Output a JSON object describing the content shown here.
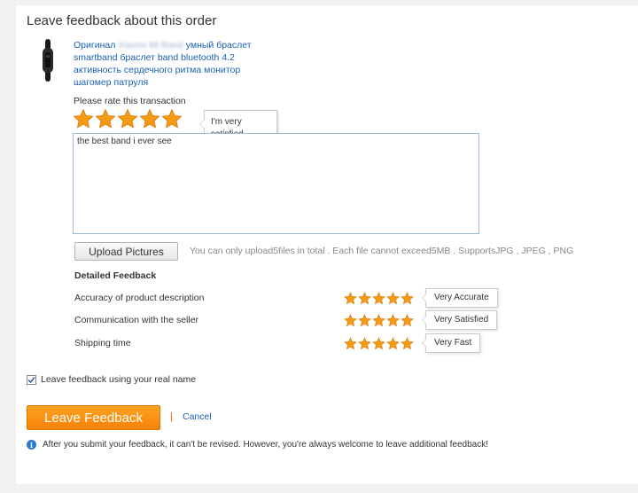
{
  "page": {
    "title": "Leave feedback about this order"
  },
  "product": {
    "title_prefix": "Оригинал",
    "title_blurred": "Xiaomi Mi Band",
    "title_suffix": "умный браслет smartband браслет band bluetooth 4.2 активность сердечного ритма монитор шагомер патруля"
  },
  "rating": {
    "label": "Please rate this transaction",
    "stars": 5,
    "max_stars": 5,
    "tooltip": "I'm very satisfied",
    "star_color": "#f49b15"
  },
  "feedback": {
    "text": "the best band i ever see"
  },
  "upload": {
    "button_label": "Upload Pictures",
    "hint": "You can only upload5files in total . Each file cannot exceed5MB . SupportsJPG , JPEG , PNG"
  },
  "detailed": {
    "heading": "Detailed Feedback",
    "rows": [
      {
        "label": "Accuracy of product description",
        "stars": 5,
        "tooltip": "Very Accurate"
      },
      {
        "label": "Communication with the seller",
        "stars": 5,
        "tooltip": "Very Satisfied"
      },
      {
        "label": "Shipping time",
        "stars": 5,
        "tooltip": "Very Fast"
      }
    ]
  },
  "options": {
    "real_name_label": "Leave feedback using your real name",
    "real_name_checked": true
  },
  "actions": {
    "submit_label": "Leave Feedback",
    "separator": "|",
    "cancel_label": "Cancel"
  },
  "notice": {
    "icon": "info-icon",
    "text": "After you submit your feedback, it can't be revised. However, you're always welcome to leave additional feedback!"
  },
  "colors": {
    "accent": "#f68308",
    "link": "#1a5fb4",
    "info": "#2a7ad4"
  }
}
